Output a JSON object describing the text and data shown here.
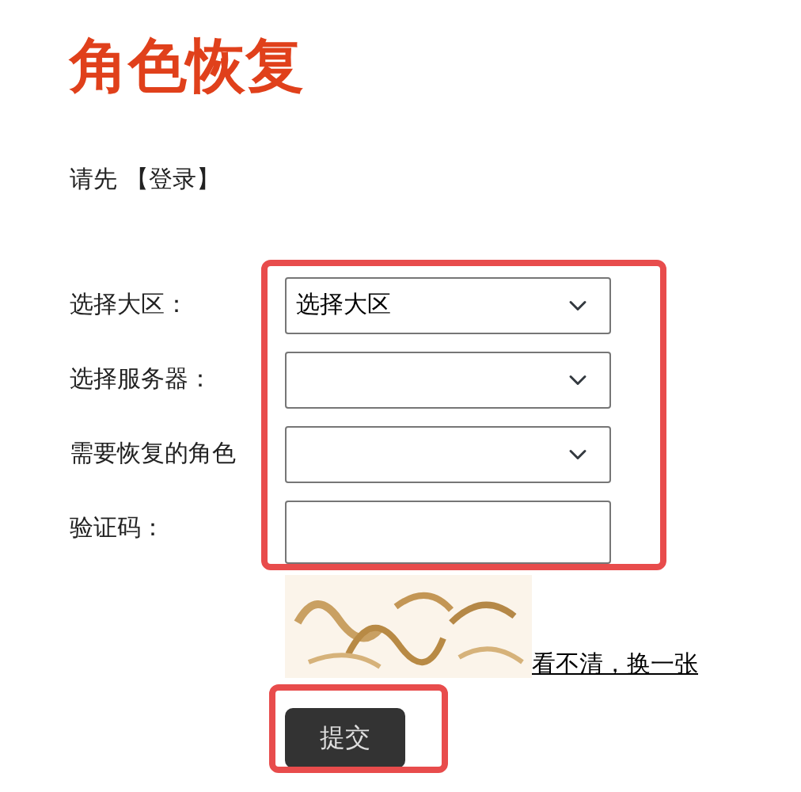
{
  "title": "角色恢复",
  "login_prompt": "请先 【登录】",
  "form": {
    "highlighted": true,
    "fields": [
      {
        "label": "选择大区：",
        "kind": "select",
        "value": "选择大区"
      },
      {
        "label": "选择服务器：",
        "kind": "select"
      },
      {
        "label": "需要恢复的角色",
        "kind": "select"
      },
      {
        "label": "验证码：",
        "kind": "input"
      }
    ]
  },
  "captcha": {
    "kind": "picture",
    "refresh_link": "看不清，换一张"
  },
  "submit": {
    "label": "提交",
    "highlighted": true
  }
}
